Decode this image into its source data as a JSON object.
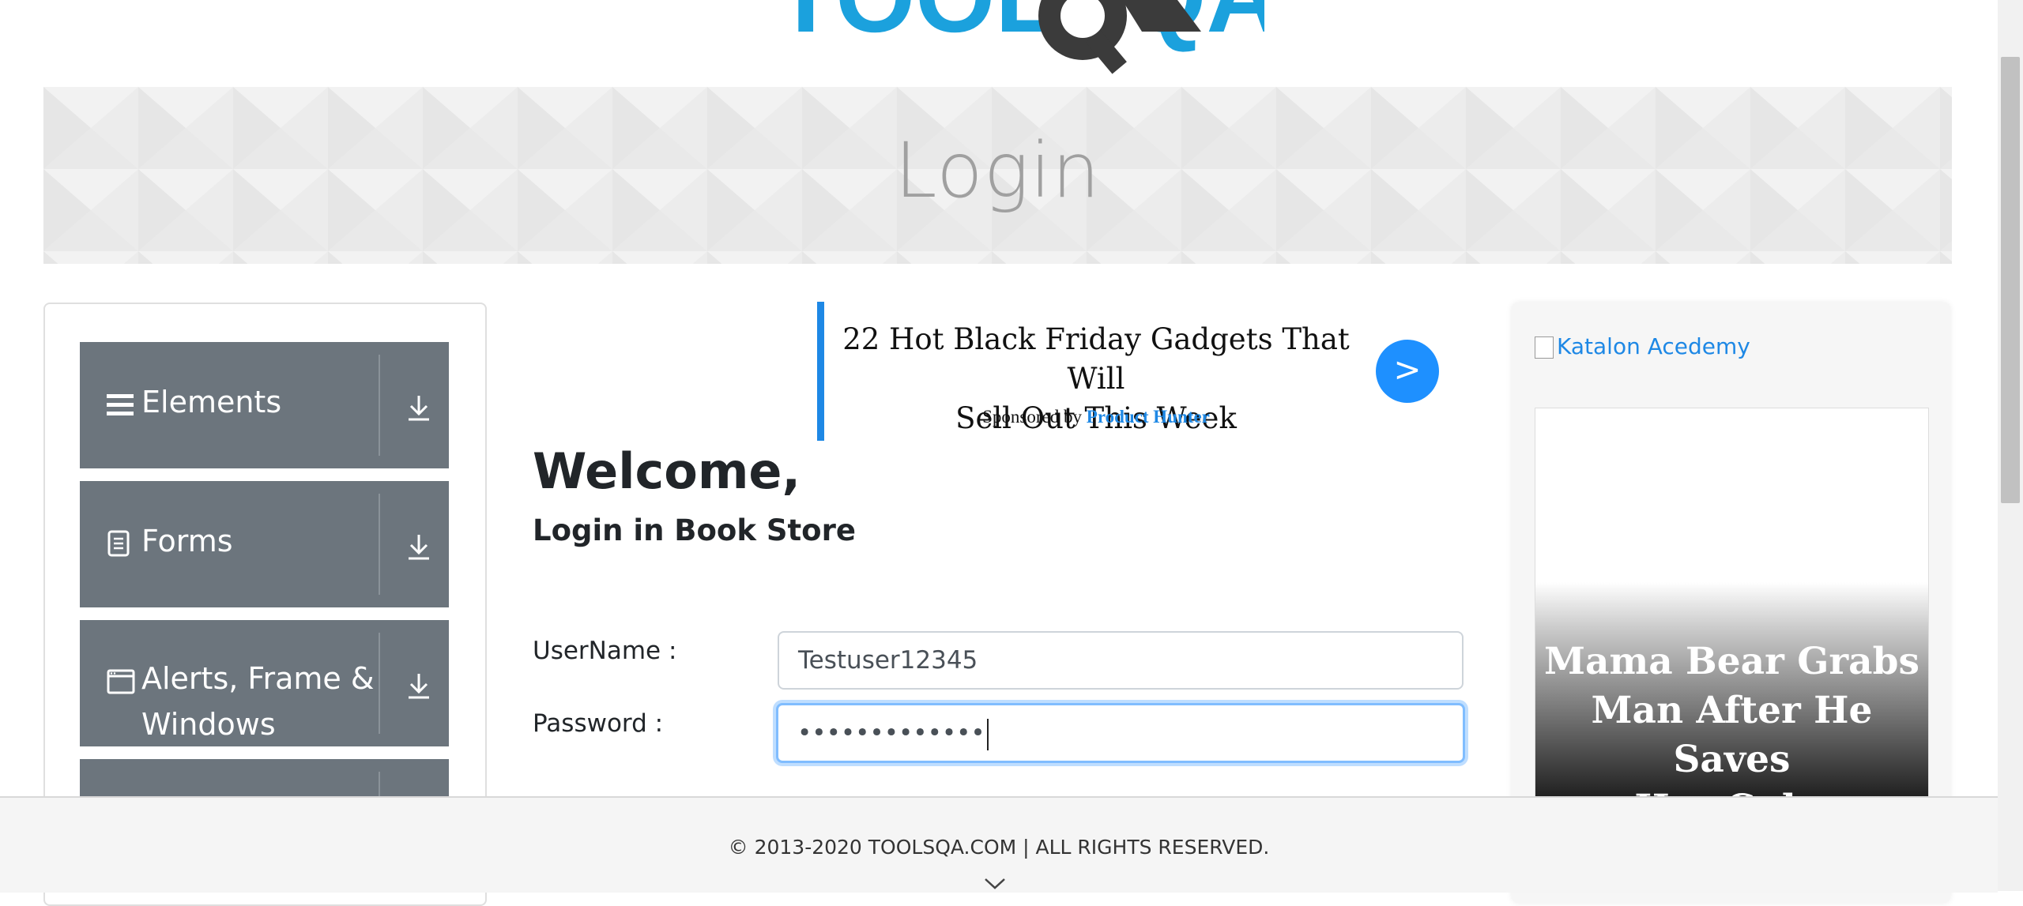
{
  "logo": {
    "text": "TOOLSQA",
    "icon": "gear-magnifier-icon",
    "colors": {
      "blue": "#1ba1dd",
      "dark": "#3b3b3b"
    }
  },
  "banner": {
    "title": "Login"
  },
  "menu": {
    "items": [
      {
        "label": "Elements",
        "icon": "bars-icon"
      },
      {
        "label": "Forms",
        "icon": "document-icon"
      },
      {
        "label": "Alerts, Frame &",
        "label2": "Windows",
        "icon": "window-icon"
      }
    ]
  },
  "ad": {
    "headline_line1": "22 Hot Black Friday Gadgets That Will",
    "headline_line2": "Sell Out This Week",
    "sponsored_prefix": "Sponsored by",
    "sponsor": "Product Hunter",
    "button": ">"
  },
  "login": {
    "heading": "Welcome,",
    "subheading": "Login in Book Store",
    "username_label": "UserName :",
    "username_value": "Testuser12345",
    "password_label": "Password :",
    "password_value": "•••••••••••••"
  },
  "side_ad": {
    "link_alt": "Katalon Acedemy",
    "headline_line1": "Mama Bear Grabs",
    "headline_line2": "Man After He Saves",
    "headline_line3": "Her Cubs"
  },
  "footer": {
    "copyright": "© 2013-2020 TOOLSQA.COM | ALL RIGHTS RESERVED."
  },
  "colors": {
    "accent": "#1e88e5",
    "menu_bg": "#6c757d",
    "focus": "#80bdff"
  }
}
